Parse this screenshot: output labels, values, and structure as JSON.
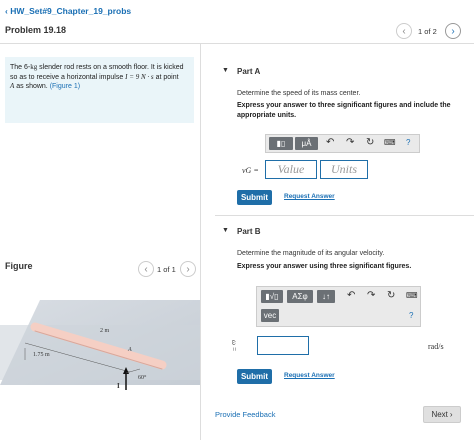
{
  "breadcrumb": {
    "label": "HW_Set#9_Chapter_19_probs"
  },
  "header": {
    "title": "Problem 19.18",
    "pager": "1 of 2"
  },
  "problem": {
    "line1_a": "The 6-",
    "line1_unit": "kg",
    "line1_b": " slender rod rests on a smooth floor. It is kicked",
    "line2_a": "so as to receive a horizontal impulse ",
    "line2_math": "I = 9  N · s",
    "line2_b": " at point",
    "line3_a": "A",
    "line3_b": " as shown. ",
    "figure_link": "(Figure 1)"
  },
  "figure": {
    "label": "Figure",
    "pager": "1 of 1",
    "labels": {
      "rod_length": "2 m",
      "offset": "1.75 m",
      "point": "A",
      "impulse": "I",
      "angle": "60°"
    }
  },
  "partA": {
    "title": "Part A",
    "prompt": "Determine the speed of its mass center.",
    "instruction": "Express your answer to three significant figures and include the appropriate units.",
    "toolbar": {
      "template_btn": "▮▯",
      "mu_btn": "μÅ",
      "help": "?"
    },
    "var_label": "vG =",
    "value_placeholder": "Value",
    "units_placeholder": "Units",
    "submit": "Submit",
    "request_answer": "Request Answer"
  },
  "partB": {
    "title": "Part B",
    "prompt": "Determine the magnitude of its angular velocity.",
    "instruction": "Express your answer using three significant figures.",
    "toolbar": {
      "root_btn": "▮√▯",
      "sigma_btn": "ΑΣφ",
      "arrows_btn": "↓↑",
      "vec_btn": "vec",
      "help": "?"
    },
    "var_label": "ω =",
    "unit": "rad/s",
    "submit": "Submit",
    "request_answer": "Request Answer"
  },
  "footer": {
    "feedback": "Provide Feedback",
    "next": "Next"
  }
}
